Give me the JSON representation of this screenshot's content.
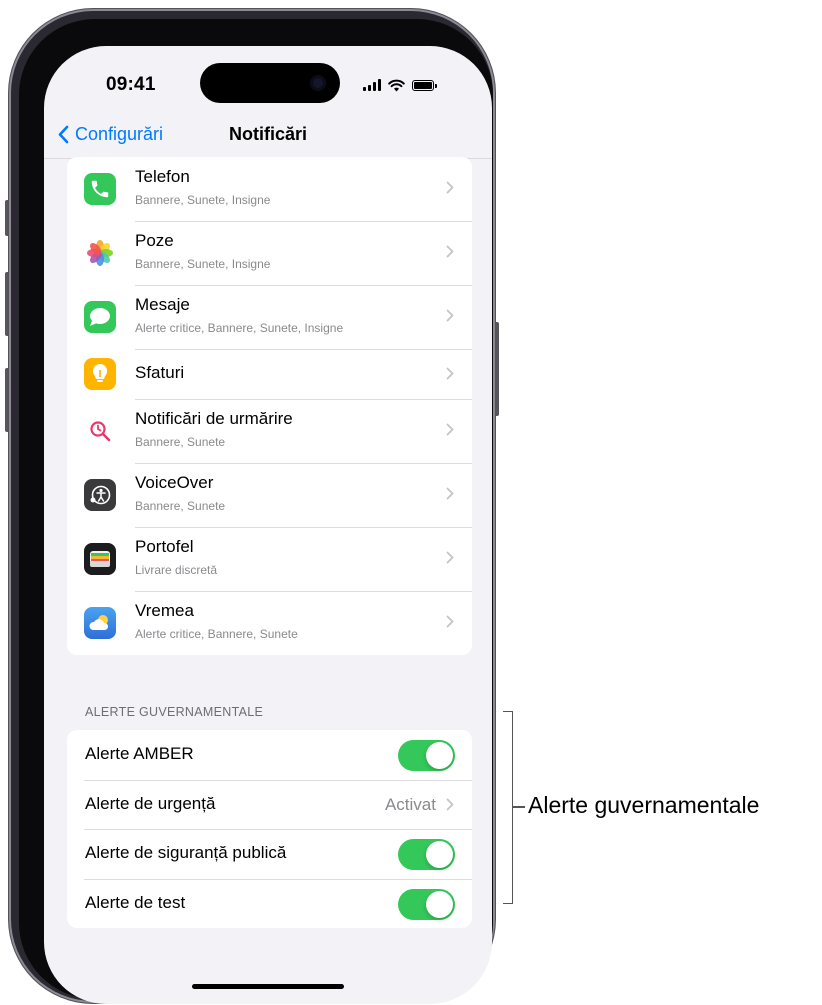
{
  "status_bar": {
    "time": "09:41",
    "icons": [
      "signal-icon",
      "wifi-icon",
      "battery-icon"
    ]
  },
  "nav": {
    "back_label": "Configurări",
    "title": "Notificări"
  },
  "apps": [
    {
      "name": "Telefon",
      "subtitle": "Bannere, Sunete, Insigne",
      "icon": "phone-icon",
      "color": "#34c759"
    },
    {
      "name": "Poze",
      "subtitle": "Bannere, Sunete, Insigne",
      "icon": "photos-icon",
      "color": "#ffffff"
    },
    {
      "name": "Mesaje",
      "subtitle": "Alerte critice, Bannere, Sunete, Insigne",
      "icon": "messages-icon",
      "color": "#34c759"
    },
    {
      "name": "Sfaturi",
      "subtitle": "",
      "icon": "tips-icon",
      "color": "#ffb400"
    },
    {
      "name": "Notificări de urmărire",
      "subtitle": "Bannere, Sunete",
      "icon": "tracking-icon",
      "color": "#ffffff"
    },
    {
      "name": "VoiceOver",
      "subtitle": "Bannere, Sunete",
      "icon": "voiceover-icon",
      "color": "#3a3a3c"
    },
    {
      "name": "Portofel",
      "subtitle": "Livrare discretă",
      "icon": "wallet-icon",
      "color": "#1c1c1e"
    },
    {
      "name": "Vremea",
      "subtitle": "Alerte critice, Bannere, Sunete",
      "icon": "weather-icon",
      "color": "#2f80ed"
    }
  ],
  "government_alerts": {
    "header": "ALERTE GUVERNAMENTALE",
    "rows": [
      {
        "label": "Alerte AMBER",
        "type": "toggle",
        "on": true
      },
      {
        "label": "Alerte de urgență",
        "type": "value",
        "value": "Activat"
      },
      {
        "label": "Alerte de siguranță publică",
        "type": "toggle",
        "on": true
      },
      {
        "label": "Alerte de test",
        "type": "toggle",
        "on": true
      }
    ]
  },
  "callout": {
    "label": "Alerte guvernamentale"
  },
  "colors": {
    "accent": "#007aff",
    "toggle_on": "#34c759",
    "background": "#f2f2f7"
  }
}
